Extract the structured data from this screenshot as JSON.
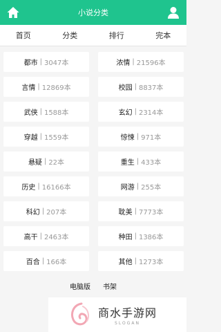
{
  "header": {
    "title": "小说分类",
    "home_icon": "home-icon",
    "user_icon": "user-icon",
    "bg_color": "#1fc48e"
  },
  "nav": [
    {
      "label": "首页"
    },
    {
      "label": "分类"
    },
    {
      "label": "排行"
    },
    {
      "label": "完本"
    }
  ],
  "categories": [
    {
      "name": "都市",
      "sep": "|",
      "count": "3047本"
    },
    {
      "name": "浓情",
      "sep": "|",
      "count": "21596本"
    },
    {
      "name": "言情",
      "sep": "|",
      "count": "12869本"
    },
    {
      "name": "校园",
      "sep": "|",
      "count": "8837本"
    },
    {
      "name": "武侠",
      "sep": "|",
      "count": "1588本"
    },
    {
      "name": "玄幻",
      "sep": "|",
      "count": "2314本"
    },
    {
      "name": "穿越",
      "sep": "|",
      "count": "1559本"
    },
    {
      "name": "惊悚",
      "sep": "|",
      "count": "971本"
    },
    {
      "name": "悬疑",
      "sep": "|",
      "count": "22本"
    },
    {
      "name": "重生",
      "sep": "|",
      "count": "433本"
    },
    {
      "name": "历史",
      "sep": "|",
      "count": "16166本"
    },
    {
      "name": "网游",
      "sep": "|",
      "count": "255本"
    },
    {
      "name": "科幻",
      "sep": "|",
      "count": "207本"
    },
    {
      "name": "耽美",
      "sep": "|",
      "count": "7773本"
    },
    {
      "name": "高干",
      "sep": "|",
      "count": "2463本"
    },
    {
      "name": "种田",
      "sep": "|",
      "count": "1386本"
    },
    {
      "name": "百合",
      "sep": "|",
      "count": "166本"
    },
    {
      "name": "其他",
      "sep": "|",
      "count": "1273本"
    }
  ],
  "footer": {
    "desktop_label": "电脑版",
    "bookshelf_label": "书架"
  },
  "watermark": {
    "name": "商水手游网",
    "slogan": "SLOGAN",
    "logo_icon": "swirl-logo-icon"
  }
}
